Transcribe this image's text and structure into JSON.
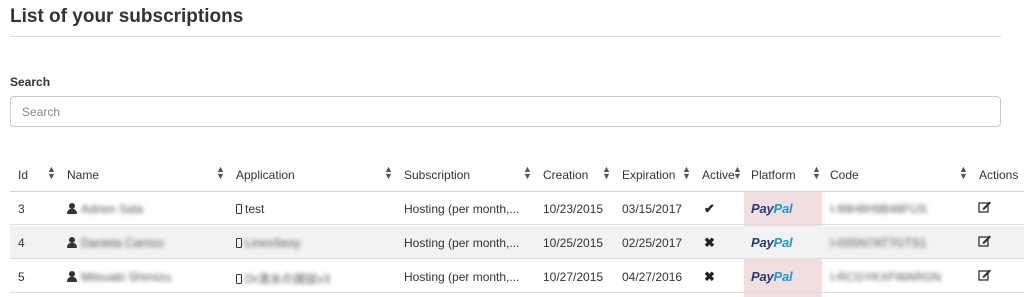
{
  "page": {
    "title": "List of your subscriptions"
  },
  "search": {
    "label": "Search",
    "placeholder": "Search"
  },
  "table": {
    "columns": [
      "Id",
      "Name",
      "Application",
      "Subscription",
      "Creation",
      "Expiration",
      "Active",
      "Platform",
      "Code",
      "Actions"
    ],
    "rows": [
      {
        "id": "3",
        "name": "Adrien Sala",
        "application": "test",
        "subscription": "Hosting (per month,...",
        "creation": "10/23/2015",
        "expiration": "03/15/2017",
        "active": "✔",
        "platform": {
          "pay": "Pay",
          "pal": "Pal"
        },
        "code": "I-99H8H9B48FUS"
      },
      {
        "id": "4",
        "name": "Daniela Carrizo",
        "application": "LinesSexy",
        "subscription": "Hosting (per month,...",
        "creation": "10/25/2015",
        "expiration": "02/25/2017",
        "active": "✖",
        "platform": {
          "pay": "Pay",
          "pal": "Pal"
        },
        "code": "I-0S5N7AT7GTS1"
      },
      {
        "id": "5",
        "name": "Mitsuaki Shimizu",
        "application": "Dr清水の雑談v3",
        "subscription": "Hosting (per month,...",
        "creation": "10/27/2015",
        "expiration": "04/27/2016",
        "active": "✖",
        "platform": {
          "pay": "Pay",
          "pal": "Pal"
        },
        "code": "I-RCGYKXFWARGN"
      }
    ]
  },
  "icons": {
    "user": "user-icon",
    "mobile": "mobile-icon",
    "edit": "edit-icon",
    "sort": "sort-icon"
  },
  "colors": {
    "platform_highlight": "#f1dede",
    "paypal_dark": "#253b80",
    "paypal_light": "#179bd7",
    "stripe": "#f2f2f2"
  }
}
